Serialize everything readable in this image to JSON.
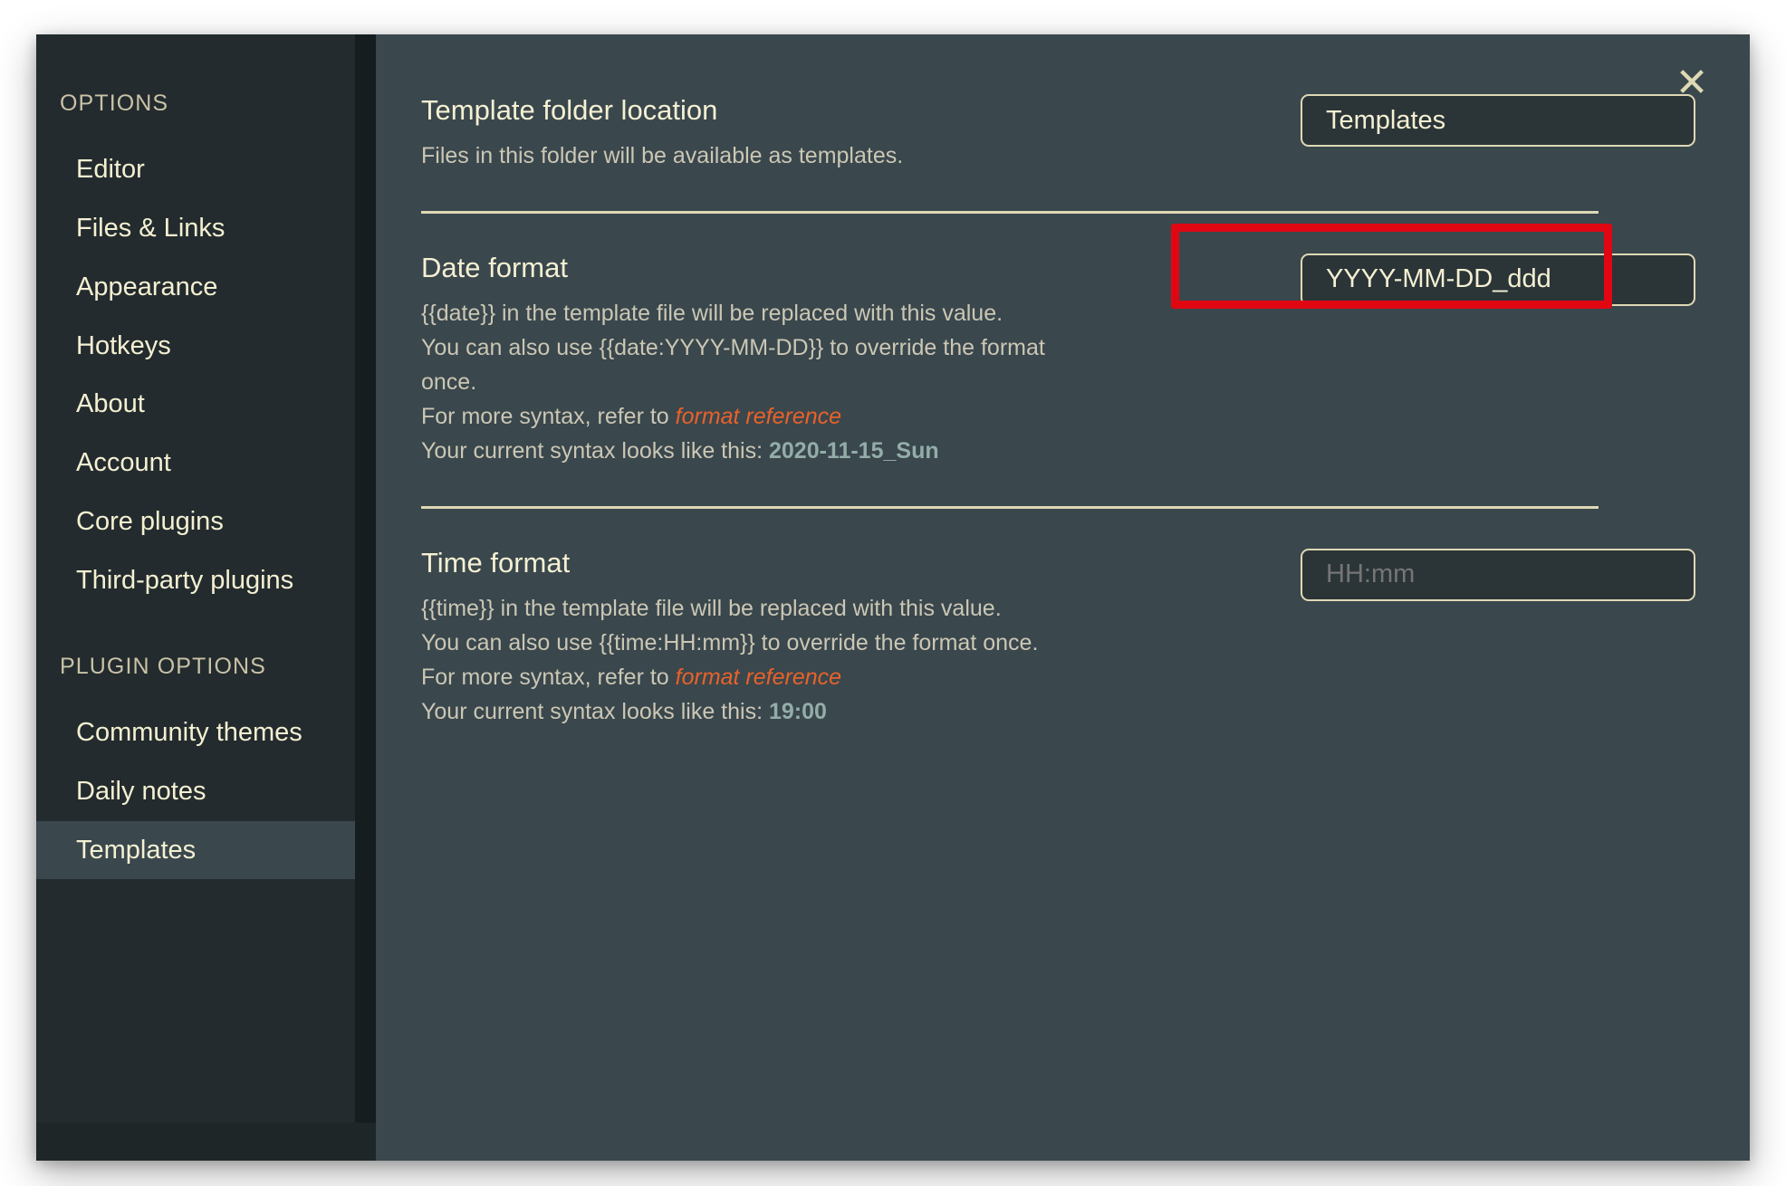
{
  "window": {
    "close_icon": "close-icon",
    "close_glyph": "✕"
  },
  "sidebar": {
    "sections": [
      {
        "heading": "OPTIONS",
        "items": [
          {
            "label": "Editor",
            "selected": false
          },
          {
            "label": "Files & Links",
            "selected": false
          },
          {
            "label": "Appearance",
            "selected": false
          },
          {
            "label": "Hotkeys",
            "selected": false
          },
          {
            "label": "About",
            "selected": false
          },
          {
            "label": "Account",
            "selected": false
          },
          {
            "label": "Core plugins",
            "selected": false
          },
          {
            "label": "Third-party plugins",
            "selected": false
          }
        ]
      },
      {
        "heading": "PLUGIN OPTIONS",
        "items": [
          {
            "label": "Community themes",
            "selected": false
          },
          {
            "label": "Daily notes",
            "selected": false
          },
          {
            "label": "Templates",
            "selected": true
          }
        ]
      }
    ]
  },
  "settings": {
    "template_folder": {
      "name": "Template folder location",
      "desc_lines": [
        "Files in this folder will be available as templates."
      ],
      "input_value": "Templates",
      "input_placeholder": "Templates"
    },
    "date_format": {
      "name": "Date format",
      "desc_line1": "{{date}} in the template file will be replaced with this value.",
      "desc_line2": "You can also use {{date:YYYY-MM-DD}} to override the format",
      "desc_line3": "once.",
      "desc_line4_prefix": "For more syntax, refer to ",
      "desc_line4_link": "format reference",
      "desc_line5_prefix": "Your current syntax looks like this: ",
      "desc_line5_sample": "2020-11-15_Sun",
      "input_value": "YYYY-MM-DD_ddd",
      "input_placeholder": "YYYY-MM-DD"
    },
    "time_format": {
      "name": "Time format",
      "desc_line1": "{{time}} in the template file will be replaced with this value.",
      "desc_line2": "You can also use {{time:HH:mm}} to override the format once.",
      "desc_line3_prefix": "For more syntax, refer to ",
      "desc_line3_link": "format reference",
      "desc_line4_prefix": "Your current syntax looks like this: ",
      "desc_line4_sample": "19:00",
      "input_value": "",
      "input_placeholder": "HH:mm"
    }
  },
  "annotation": {
    "target": "date-format-input",
    "color": "#e00713"
  },
  "colors": {
    "sidebar_bg": "#232b2e",
    "panel_bg": "#3a474d",
    "input_bg": "#2b3538",
    "accent_cream": "#f4f0d2",
    "muted_text": "#cbc7b4",
    "link_orange": "#e8622a",
    "sample_teal": "#93ada8",
    "divider": "#ded8b4",
    "annotation_red": "#e00713"
  }
}
